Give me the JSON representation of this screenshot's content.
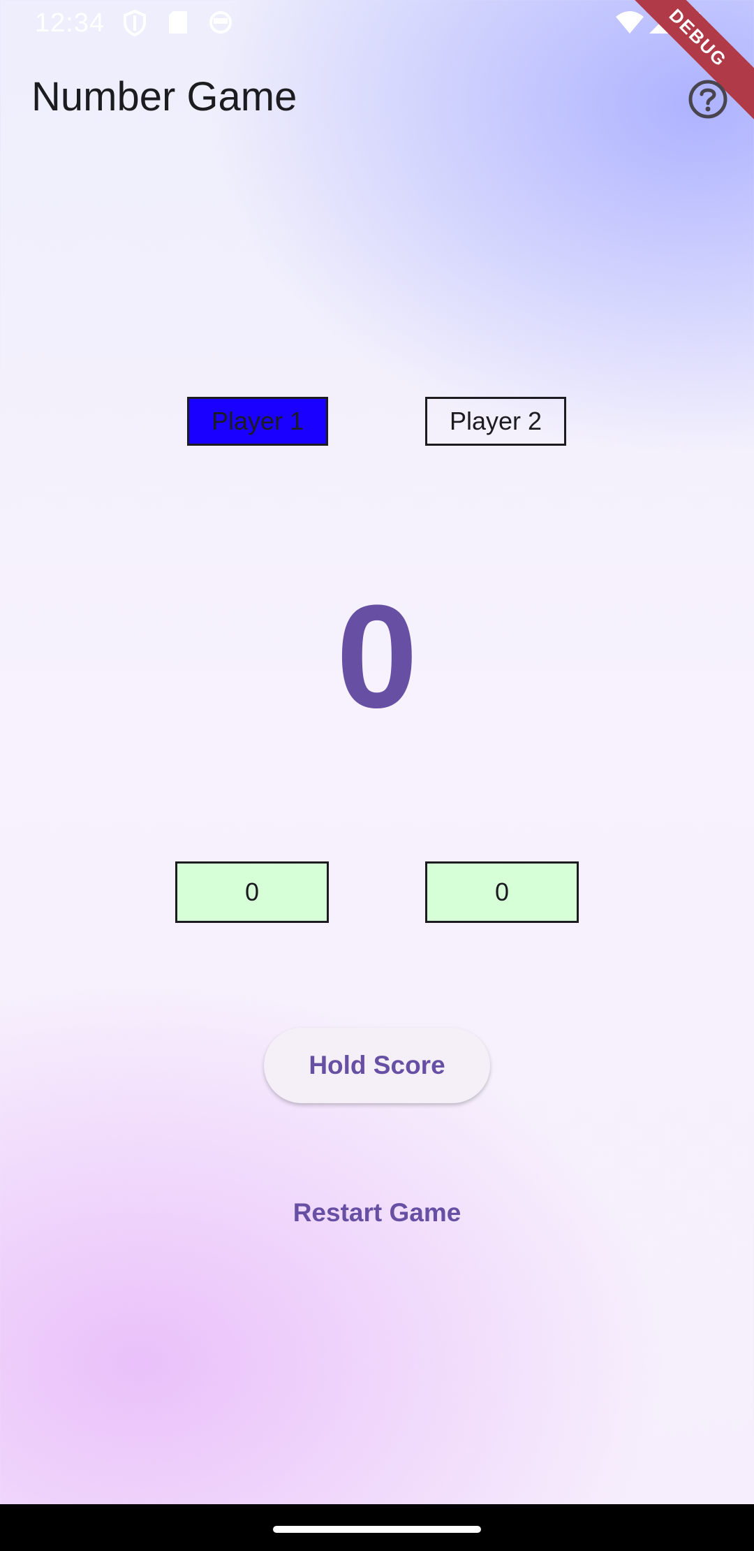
{
  "status_bar": {
    "time": "12:34",
    "icons": [
      "shield-icon",
      "sd-card-icon",
      "robot-face-icon",
      "wifi-icon",
      "signal-icon",
      "battery-icon"
    ]
  },
  "debug_banner": {
    "label": "DEBUG"
  },
  "app_bar": {
    "title": "Number Game",
    "help_icon": "help-circle-icon"
  },
  "players": [
    {
      "label": "Player 1",
      "active": true,
      "color": "#1a00ff"
    },
    {
      "label": "Player 2",
      "active": false
    }
  ],
  "current_number": "0",
  "scores": [
    "0",
    "0"
  ],
  "actions": {
    "hold_label": "Hold Score",
    "restart_label": "Restart Game"
  },
  "colors": {
    "accent": "#6750a4",
    "score_bg": "#d6ffd8",
    "active_player": "#1a00ff"
  }
}
